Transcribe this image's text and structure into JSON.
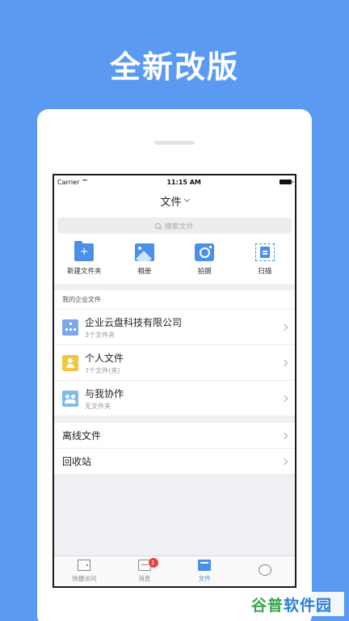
{
  "headline": "全新改版",
  "status": {
    "carrier": "Carrier",
    "time": "11:15 AM"
  },
  "nav": {
    "title": "文件"
  },
  "search": {
    "placeholder": "搜索文件"
  },
  "actions": [
    {
      "label": "新建文件夹",
      "icon": "new-folder-icon"
    },
    {
      "label": "相册",
      "icon": "album-icon"
    },
    {
      "label": "拍摄",
      "icon": "camera-icon"
    },
    {
      "label": "扫描",
      "icon": "scan-icon"
    }
  ],
  "enterprise": {
    "section_label": "我的企业文件",
    "items": [
      {
        "name": "企业云盘科技有限公司",
        "sub": "3个文件夹",
        "icon": "org-icon",
        "color": "#7EA8E8"
      },
      {
        "name": "个人文件",
        "sub": "7个文件(夹)",
        "icon": "person-icon",
        "color": "#F5C542"
      },
      {
        "name": "与我协作",
        "sub": "无文件夹",
        "icon": "collaboration-icon",
        "color": "#7FBDE8"
      }
    ]
  },
  "others": [
    {
      "name": "离线文件"
    },
    {
      "name": "回收站"
    }
  ],
  "tabs": [
    {
      "label": "快捷访问",
      "icon": "door-icon"
    },
    {
      "label": "消息",
      "icon": "message-icon",
      "badge": "1"
    },
    {
      "label": "文件",
      "icon": "file-icon",
      "active": true
    },
    {
      "label": "",
      "icon": "profile-icon"
    }
  ],
  "watermark": {
    "part1": "谷普",
    "part2": "软件园"
  },
  "colors": {
    "background": "#5B9AF2",
    "accent": "#4A8FEA",
    "badge": "#E8423F"
  }
}
